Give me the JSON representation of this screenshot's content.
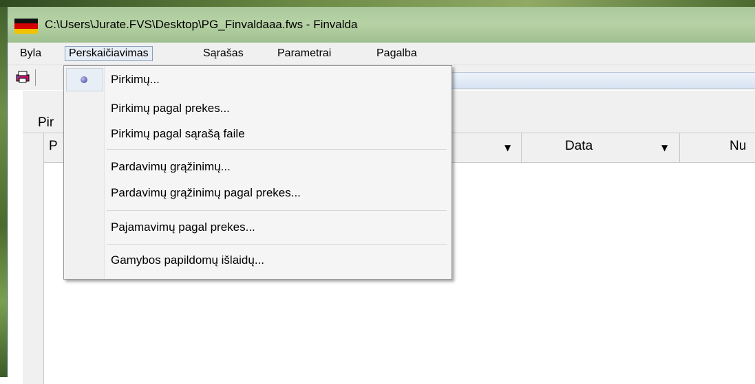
{
  "window": {
    "title": "C:\\Users\\Jurate.FVS\\Desktop\\PG_Finvaldaaa.fws - Finvalda"
  },
  "menubar": {
    "items": [
      {
        "label": "Byla"
      },
      {
        "label": "Perskaičiavimas"
      },
      {
        "label": "Sąrašas"
      },
      {
        "label": "Parametrai"
      },
      {
        "label": "Pagalba"
      }
    ]
  },
  "toolbar": {
    "icon": "print-icon"
  },
  "tabs": {
    "active_label": "Pir"
  },
  "grid": {
    "columns": [
      {
        "label": "P"
      },
      {
        "label": "Data"
      },
      {
        "label": "Nu"
      }
    ]
  },
  "dropdown": {
    "items": [
      {
        "label": "Pirkimų...",
        "selected": true
      },
      {
        "label": "Pirkimų pagal prekes..."
      },
      {
        "label": "Pirkimų pagal sąrašą faile"
      },
      {
        "label": "Pardavimų grąžinimų..."
      },
      {
        "label": "Pardavimų grąžinimų pagal prekes..."
      },
      {
        "label": "Pajamavimų pagal prekes..."
      },
      {
        "label": "Gamybos papildomų išlaidų..."
      }
    ]
  },
  "colors": {
    "titlebar": "#b7d3a6",
    "menu_highlight": "#e6edf5",
    "radio": "#3a3f9a"
  }
}
